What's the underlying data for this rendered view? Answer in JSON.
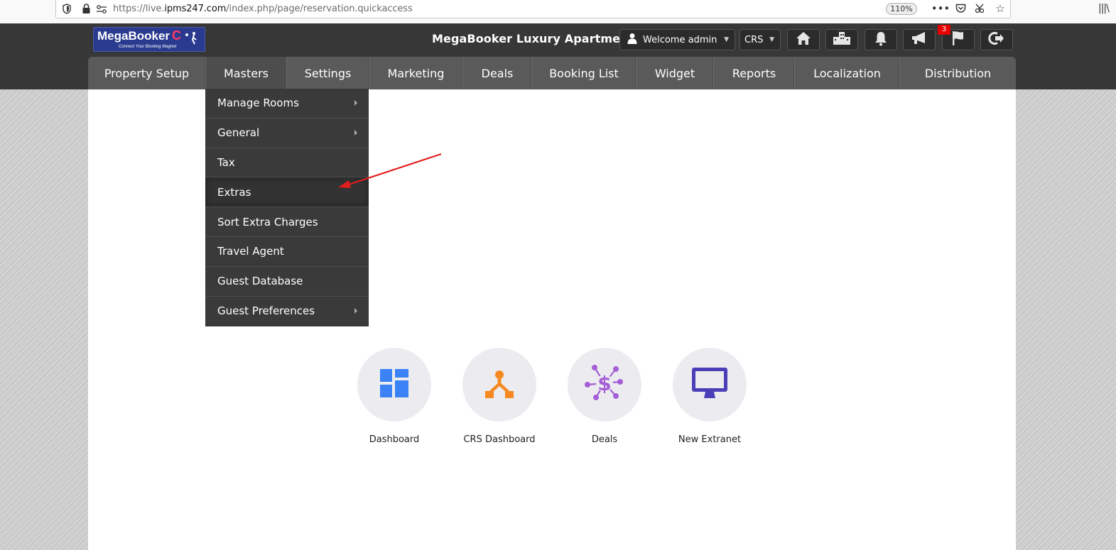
{
  "browser": {
    "url_prefix": "https://live.",
    "url_host": "ipms247.com",
    "url_path": "/index.php/page/reservation.quickaccess",
    "zoom": "110%"
  },
  "header": {
    "logo_brand": "MegaBooker",
    "logo_tagline": "Connect Your Booking Magnet",
    "property_name": "MegaBooker Luxury Apartments",
    "welcome_label": "Welcome admin",
    "crs_label": "CRS",
    "notification_count": "3",
    "icons": [
      "home-icon",
      "hotels-icon",
      "bell-icon",
      "megaphone-icon",
      "flag-icon",
      "logout-icon"
    ]
  },
  "nav": {
    "items": [
      "Property Setup",
      "Masters",
      "Settings",
      "Marketing",
      "Deals",
      "Booking List",
      "Widget",
      "Reports",
      "Localization",
      "Distribution"
    ],
    "active": "Masters"
  },
  "masters_menu": {
    "items": [
      "Manage Rooms",
      "General",
      "Tax",
      "Extras",
      "Sort Extra Charges",
      "Travel Agent",
      "Guest Database",
      "Guest Preferences"
    ],
    "highlighted": "Extras"
  },
  "quick_access": {
    "tiles": [
      {
        "label": "Dashboard",
        "icon": "dashboard-icon",
        "color": "#3b82f6"
      },
      {
        "label": "CRS Dashboard",
        "icon": "crs-network-icon",
        "color": "#f5891f"
      },
      {
        "label": "Deals",
        "icon": "dollar-network-icon",
        "color": "#a45ed6"
      },
      {
        "label": "New Extranet",
        "icon": "monitor-icon",
        "color": "#4a3fb8"
      }
    ]
  },
  "colors": {
    "header_bg": "#373737",
    "nav_bg": "#5a5a5a",
    "dropdown_bg": "#3a3a3a",
    "annotation_arrow": "#e11d1d",
    "badge": "#e60000"
  }
}
